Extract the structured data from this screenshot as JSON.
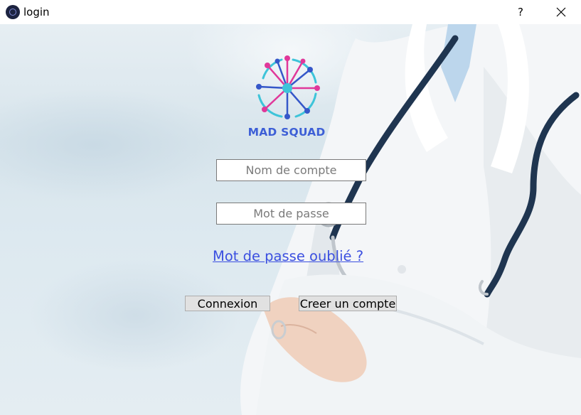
{
  "window": {
    "title": "login",
    "help_label": "?",
    "icons": {
      "app": "app-logo-icon",
      "close": "close-icon"
    }
  },
  "brand": {
    "name": "MAD SQUAD",
    "colors": {
      "text": "#3d5fd6",
      "logo_pink": "#e0389a",
      "logo_blue": "#3557c9",
      "logo_cyan": "#3ec4d9"
    }
  },
  "form": {
    "username_placeholder": "Nom de compte",
    "password_placeholder": "Mot de passe",
    "forgot_password": "Mot de passe oublié ?",
    "login_button": "Connexion",
    "create_account_button": "Creer un compte"
  },
  "colors": {
    "link": "#3b4fe0",
    "button_bg": "#e1e1e1"
  }
}
